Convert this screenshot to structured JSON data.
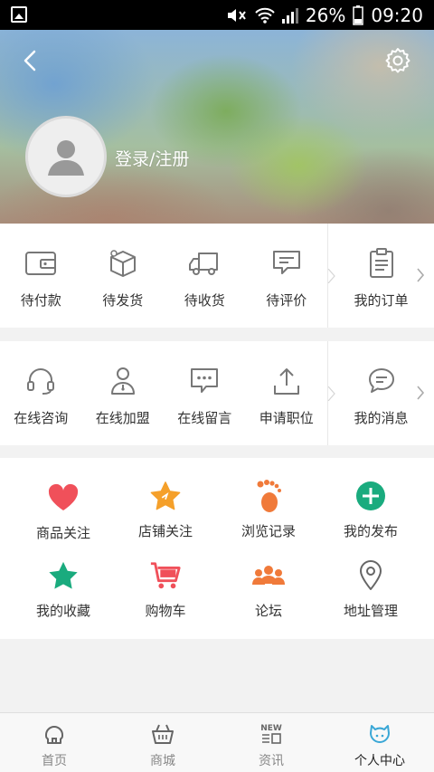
{
  "status_bar": {
    "battery": "26%",
    "time": "09:20",
    "icons": [
      "gallery-notification-icon",
      "mute-icon",
      "wifi-icon",
      "signal-icon",
      "battery-icon"
    ]
  },
  "header": {
    "login_text": "登录/注册",
    "back_icon": "chevron-left-icon",
    "settings_icon": "gear-icon"
  },
  "orders": {
    "items": [
      {
        "label": "待付款",
        "icon": "wallet-icon"
      },
      {
        "label": "待发货",
        "icon": "package-icon"
      },
      {
        "label": "待收货",
        "icon": "truck-icon"
      },
      {
        "label": "待评价",
        "icon": "comment-icon"
      }
    ],
    "side": {
      "label": "我的订单",
      "icon": "order-list-icon"
    }
  },
  "services": {
    "items": [
      {
        "label": "在线咨询",
        "icon": "headset-icon"
      },
      {
        "label": "在线加盟",
        "icon": "person-join-icon"
      },
      {
        "label": "在线留言",
        "icon": "message-dots-icon"
      },
      {
        "label": "申请职位",
        "icon": "upload-icon"
      }
    ],
    "side": {
      "label": "我的消息",
      "icon": "chat-bubble-icon"
    }
  },
  "features": {
    "items": [
      {
        "label": "商品关注",
        "icon": "heart-icon",
        "color": "#f0505a"
      },
      {
        "label": "店铺关注",
        "icon": "star-icon",
        "color": "#f5a02a"
      },
      {
        "label": "浏览记录",
        "icon": "footprint-icon",
        "color": "#f07a3a"
      },
      {
        "label": "我的发布",
        "icon": "plus-circle-icon",
        "color": "#1aab7e"
      },
      {
        "label": "我的收藏",
        "icon": "star-filled-icon",
        "color": "#1aab7e"
      },
      {
        "label": "购物车",
        "icon": "cart-icon",
        "color": "#f0505a"
      },
      {
        "label": "论坛",
        "icon": "group-icon",
        "color": "#f07a3a"
      },
      {
        "label": "地址管理",
        "icon": "location-pin-icon",
        "color": "#666666"
      }
    ]
  },
  "tabbar": {
    "tabs": [
      {
        "label": "首页",
        "icon": "home-icon",
        "active": false
      },
      {
        "label": "商城",
        "icon": "basket-icon",
        "active": false
      },
      {
        "label": "资讯",
        "icon": "news-icon",
        "icon_text": "NEW",
        "active": false
      },
      {
        "label": "个人中心",
        "icon": "mascot-icon",
        "active": true
      }
    ]
  }
}
